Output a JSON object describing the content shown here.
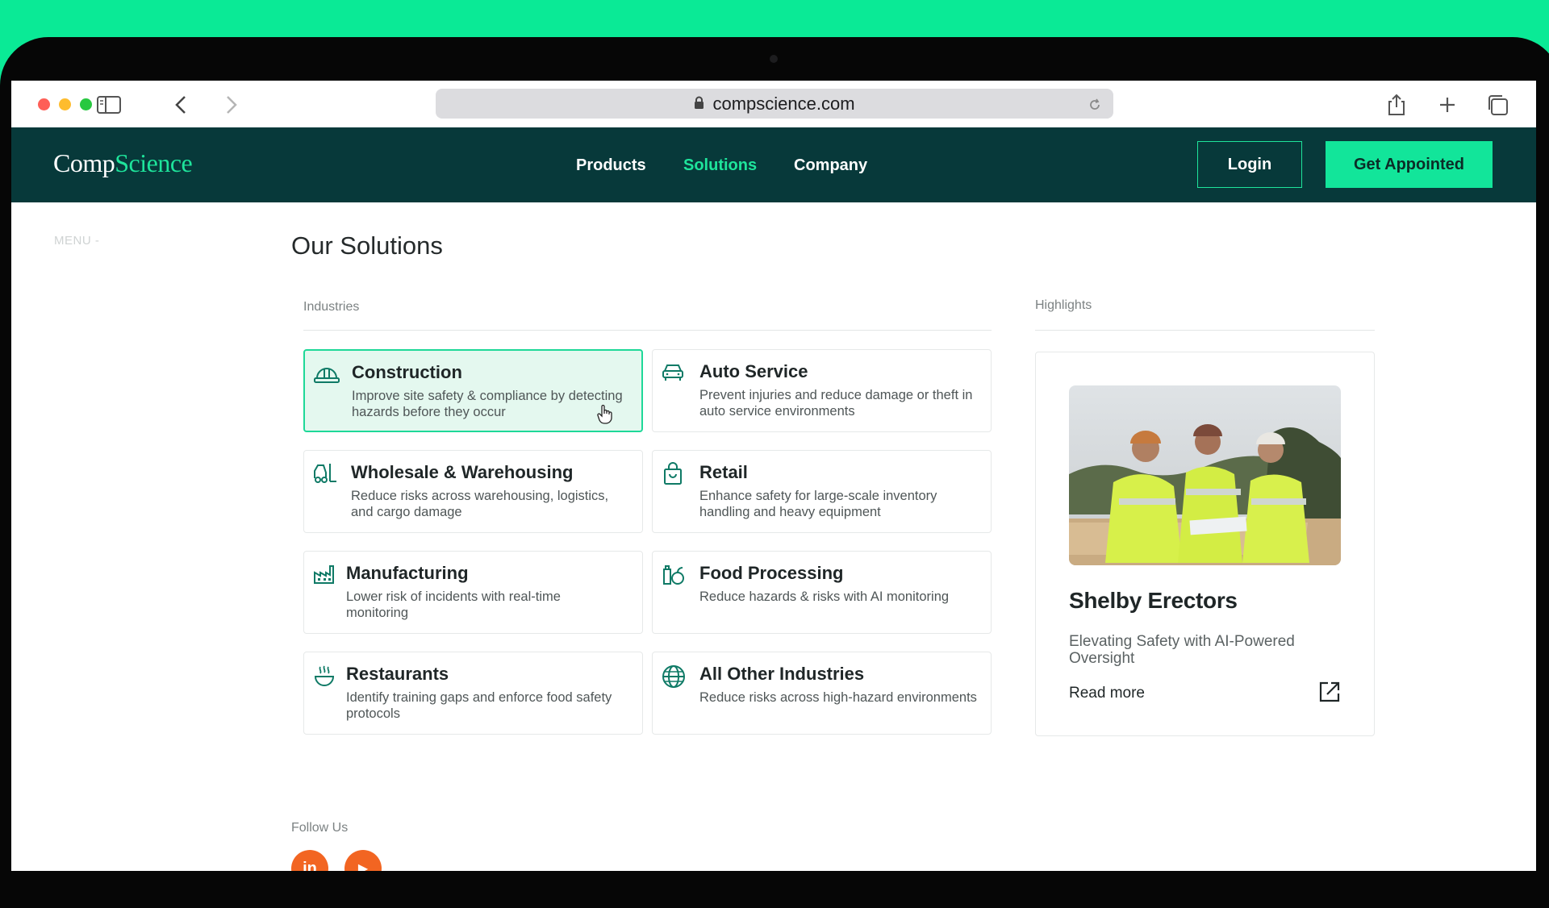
{
  "browser": {
    "url": "compscience.com"
  },
  "site_nav": {
    "logo_part1": "Comp",
    "logo_part2": "Science",
    "links": [
      {
        "label": "Products"
      },
      {
        "label": "Solutions"
      },
      {
        "label": "Company"
      }
    ],
    "login_label": "Login",
    "cta_label": "Get Appointed"
  },
  "sidebar": {
    "menu_label": "MENU -"
  },
  "main": {
    "title": "Our Solutions",
    "industries_label": "Industries",
    "highlights_label": "Highlights",
    "industries": [
      {
        "title": "Construction",
        "description": "Improve site safety & compliance by detecting hazards before they occur",
        "icon": "hard-hat-icon"
      },
      {
        "title": "Auto Service",
        "description": "Prevent injuries and reduce damage or theft in auto service environments",
        "icon": "car-icon"
      },
      {
        "title": "Wholesale & Warehousing",
        "description": "Reduce risks across warehousing, logistics, and cargo damage",
        "icon": "forklift-icon"
      },
      {
        "title": "Retail",
        "description": "Enhance safety for large-scale inventory handling and heavy equipment",
        "icon": "shopping-bag-icon"
      },
      {
        "title": "Manufacturing",
        "description": "Lower risk of incidents with real-time monitoring",
        "icon": "factory-icon"
      },
      {
        "title": "Food Processing",
        "description": "Reduce hazards & risks with AI monitoring",
        "icon": "food-jars-icon"
      },
      {
        "title": "Restaurants",
        "description": "Identify training gaps and enforce food safety protocols",
        "icon": "steaming-bowl-icon"
      },
      {
        "title": "All Other Industries",
        "description": "Reduce risks across high-hazard environments",
        "icon": "globe-icon"
      }
    ],
    "highlight": {
      "title": "Shelby Erectors",
      "subtitle": "Elevating Safety with AI-Powered Oversight",
      "link_label": "Read more"
    },
    "follow_label": "Follow Us",
    "social": [
      {
        "label": "in",
        "icon": "linkedin-icon"
      },
      {
        "label": "▶",
        "icon": "youtube-icon"
      }
    ]
  },
  "colors": {
    "accent_green": "#1ee49b",
    "nav_bg": "#07393a",
    "page_bg": "#0aea96"
  }
}
